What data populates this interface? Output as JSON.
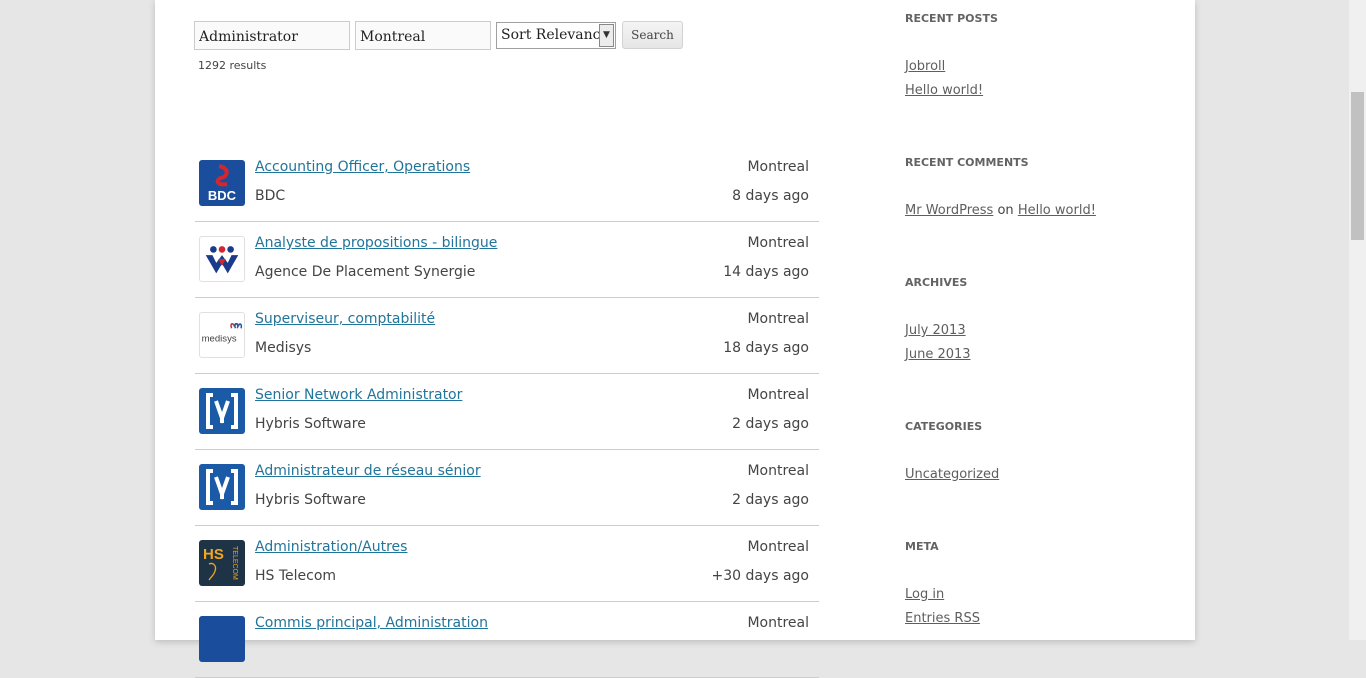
{
  "search": {
    "keyword": "Administrator",
    "location": "Montreal",
    "sort_label": "Sort Relevance",
    "button_label": "Search",
    "results_count": "1292 results"
  },
  "jobs": [
    {
      "title": "Accounting Officer, Operations",
      "company": "BDC",
      "city": "Montreal",
      "age": "8 days ago",
      "logo": "bdc-logo"
    },
    {
      "title": "Analyste de propositions - bilingue",
      "company": "Agence De Placement Synergie",
      "city": "Montreal",
      "age": "14 days ago",
      "logo": "synergie-logo"
    },
    {
      "title": "Superviseur, comptabilité",
      "company": "Medisys",
      "city": "Montreal",
      "age": "18 days ago",
      "logo": "medisys-logo"
    },
    {
      "title": "Senior Network Administrator",
      "company": "Hybris Software",
      "city": "Montreal",
      "age": "2 days ago",
      "logo": "hybris-logo"
    },
    {
      "title": "Administrateur de réseau sénior",
      "company": "Hybris Software",
      "city": "Montreal",
      "age": "2 days ago",
      "logo": "hybris-logo"
    },
    {
      "title": "Administration/Autres",
      "company": "HS Telecom",
      "city": "Montreal",
      "age": "+30 days ago",
      "logo": "hs-telecom-logo"
    },
    {
      "title": "Commis principal, Administration",
      "company": "",
      "city": "Montreal",
      "age": "",
      "logo": "company-logo"
    }
  ],
  "logos": {
    "bdc_text": "BDC",
    "medisys_text": "medisys",
    "hs_text": "HS",
    "telecom_text": "TELECOM"
  },
  "sidebar": {
    "recent_posts": {
      "title": "RECENT POSTS",
      "items": [
        "Jobroll",
        "Hello world!"
      ]
    },
    "recent_comments": {
      "title": "RECENT COMMENTS",
      "author": "Mr WordPress",
      "on": "on",
      "post": "Hello world!"
    },
    "archives": {
      "title": "ARCHIVES",
      "items": [
        "July 2013",
        "June 2013"
      ]
    },
    "categories": {
      "title": "CATEGORIES",
      "items": [
        "Uncategorized"
      ]
    },
    "meta": {
      "title": "META",
      "items": [
        "Log in",
        "Entries RSS"
      ]
    }
  },
  "colors": {
    "link": "#21759b",
    "bdc_blue": "#1a4e9c",
    "bdc_red": "#d4262e",
    "hybris_blue": "#1b5aa6",
    "hs_dark": "#1f3347",
    "hs_orange": "#f2a81d"
  }
}
